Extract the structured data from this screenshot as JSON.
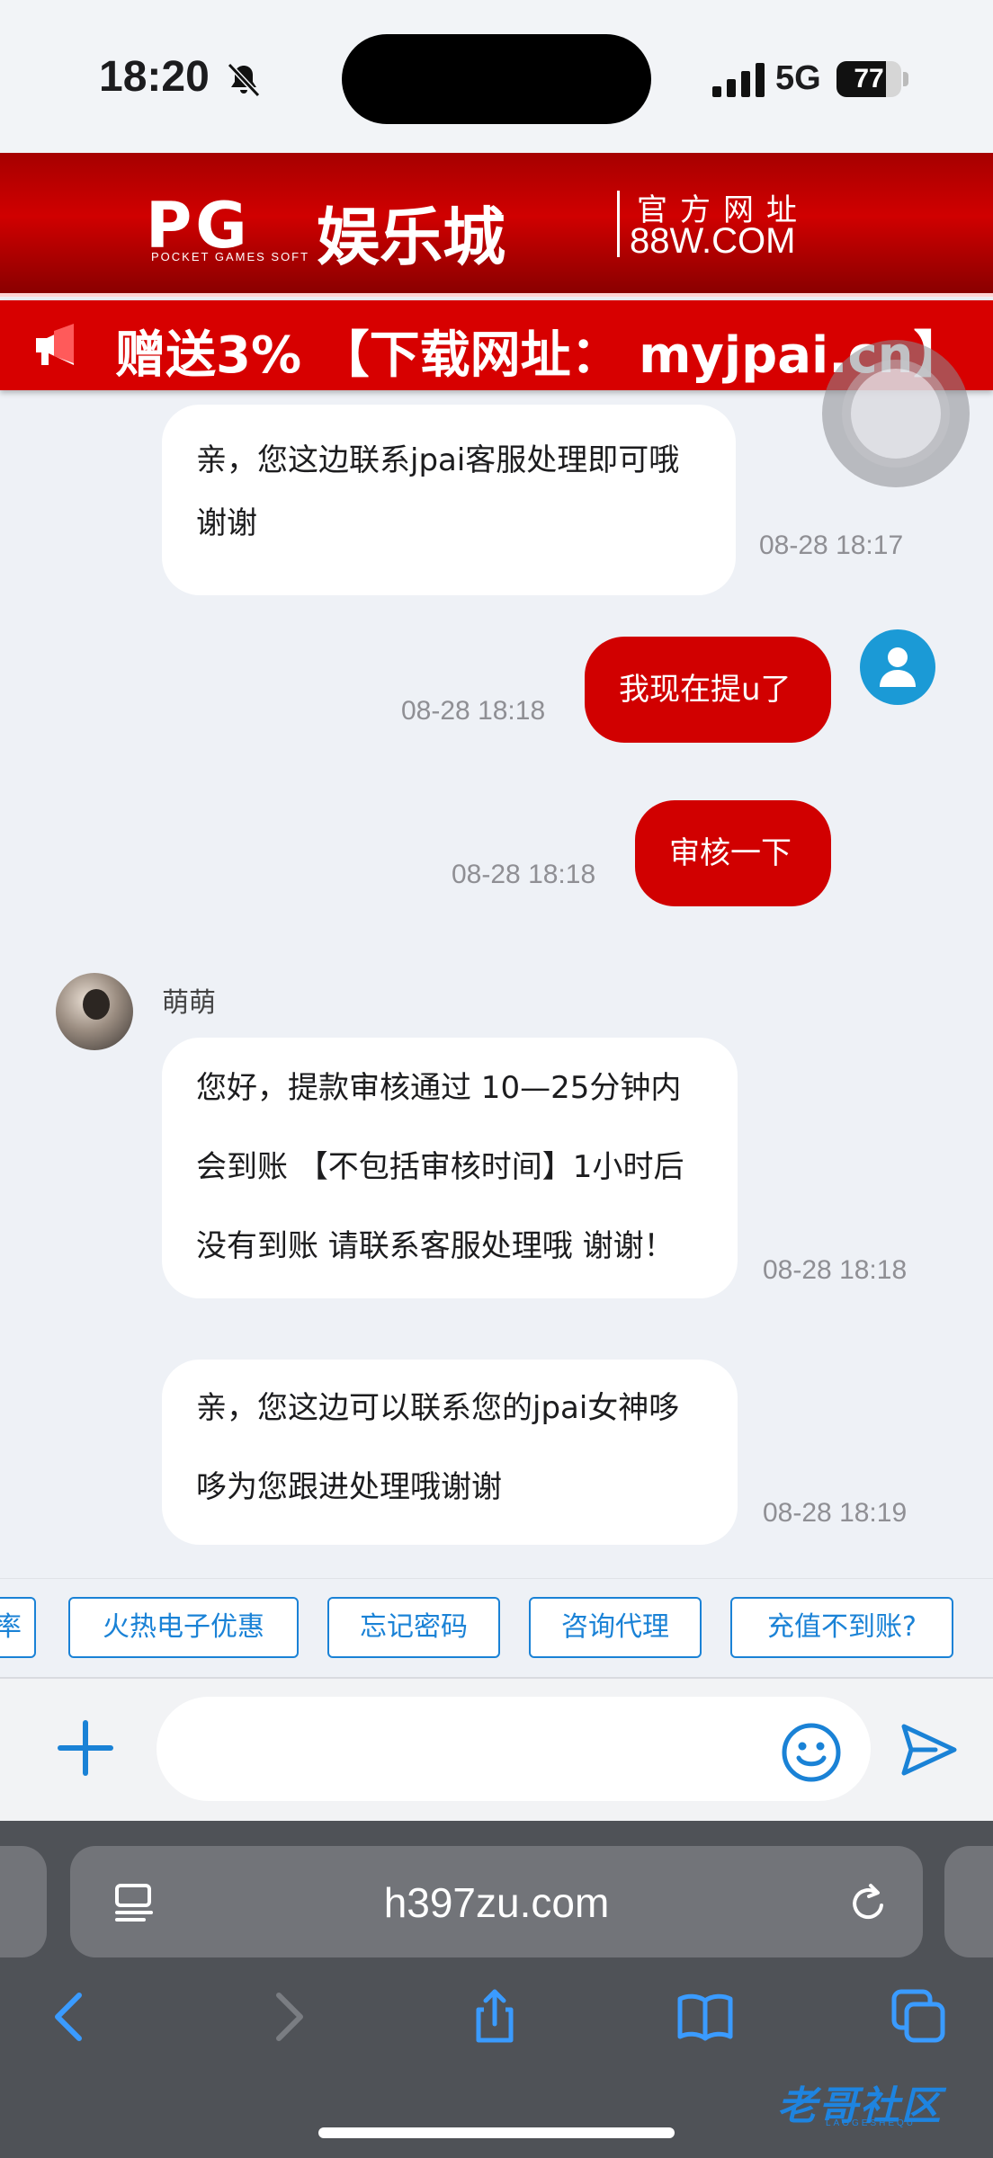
{
  "status_bar": {
    "time": "18:20",
    "network": "5G",
    "battery": "77",
    "battery_level": 0.77
  },
  "banner": {
    "logo": "PG",
    "logo_sub": "POCKET GAMES SOFT",
    "brand": "娱乐城",
    "tag_top": "官方网址",
    "tag_bottom": "88W.COM"
  },
  "marquee": {
    "text": "赠送3% 【下载网址： myjpai.cn】"
  },
  "messages": [
    {
      "type": "agent",
      "lines": [
        "亲，您这边联系jpai客服处理即可哦",
        "谢谢"
      ],
      "time": "08-28 18:17"
    },
    {
      "type": "user",
      "text": "我现在提u了",
      "time": "08-28 18:18"
    },
    {
      "type": "user",
      "text": "审核一下",
      "time": "08-28 18:18"
    },
    {
      "type": "agent",
      "name": "萌萌",
      "lines": [
        "您好，提款审核通过 10—25分钟内",
        "会到账 【不包括审核时间】1小时后",
        "没有到账 请联系客服处理哦 谢谢！"
      ],
      "time": "08-28 18:18"
    },
    {
      "type": "agent",
      "lines": [
        "亲，您这边可以联系您的jpai女神哆",
        "哆为您跟进处理哦谢谢"
      ],
      "time": "08-28 18:19"
    }
  ],
  "quick_replies": [
    "率",
    "火热电子优惠",
    "忘记密码",
    "咨询代理",
    "充值不到账?"
  ],
  "input": {
    "placeholder": ""
  },
  "browser": {
    "url": "h397zu.com"
  },
  "watermark": {
    "text": "老哥社区",
    "sub": "LAOGESHEQU"
  },
  "colors": {
    "brand_red": "#d10000",
    "accent_blue": "#1a82d6",
    "user_avatar": "#1b9ad6"
  }
}
